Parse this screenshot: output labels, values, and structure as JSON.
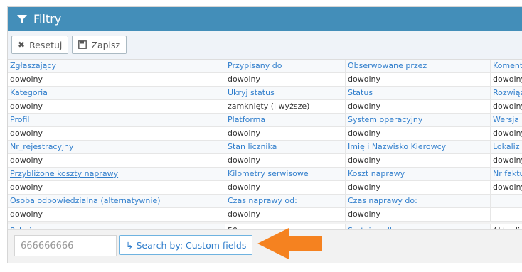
{
  "header": {
    "title": "Filtry"
  },
  "toolbar": {
    "reset_label": "Resetuj",
    "save_label": "Zapisz"
  },
  "filters": [
    {
      "labels": [
        "Zgłaszający",
        "Przypisany do",
        "Obserwowane przez",
        "Komenta"
      ],
      "values": [
        "dowolny",
        "dowolny",
        "dowolny",
        "dowolny"
      ]
    },
    {
      "labels": [
        "Kategoria",
        "Ukryj status",
        "Status",
        "Rozwiąz"
      ],
      "values": [
        "dowolny",
        "zamknięty (i wyższe)",
        "dowolny",
        "dowolny"
      ]
    },
    {
      "labels": [
        "Profil",
        "Platforma",
        "System operacyjny",
        "Wersja s"
      ],
      "values": [
        "dowolny",
        "dowolny",
        "dowolny",
        "dowolny"
      ]
    },
    {
      "labels": [
        "Nr_rejestracyjny",
        "Stan licznika",
        "Imię i Nazwisko Kierowcy",
        "Lokaliz"
      ],
      "values": [
        "dowolny",
        "dowolny",
        "dowolny",
        "dowolny"
      ]
    },
    {
      "labels": [
        "Przybliżone koszty naprawy",
        "Kilometry serwisowe",
        "Koszt naprawy",
        "Nr faktu"
      ],
      "values": [
        "dowolny",
        "dowolny",
        "dowolny",
        "dowolny"
      ]
    },
    {
      "labels": [
        "Osoba odpowiedzialna (alternatywnie)",
        "Czas naprawy od:",
        "Czas naprawy do:",
        ""
      ],
      "values": [
        "dowolny",
        "dowolny",
        "dowolny",
        ""
      ]
    }
  ],
  "show_row": {
    "label": "Pokaż",
    "value": "50",
    "sort_label": "Sortuj według",
    "sort_value": "Aktualiz"
  },
  "search": {
    "value": "666666666",
    "button_label": "Search by: Custom fields",
    "button_icon": "↳"
  },
  "colors": {
    "header_bg": "#438eb9",
    "link": "#307ecc",
    "arrow": "#f58220"
  }
}
